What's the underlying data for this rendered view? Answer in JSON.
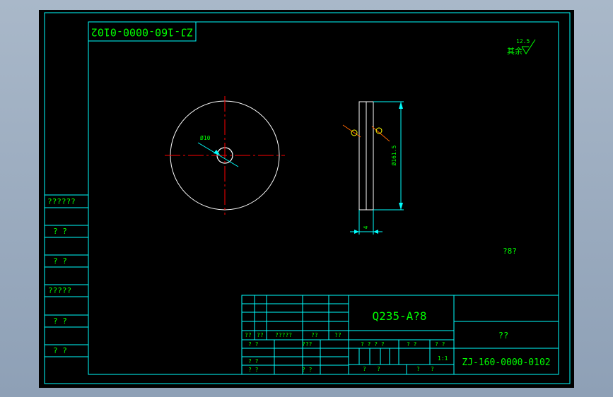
{
  "drawing_number_rotated": "ZJ-160-0000-0102",
  "surface_finish": {
    "label": "其余",
    "value": "12.5"
  },
  "views": {
    "front": {
      "hole_dimension": "Ø10"
    },
    "side": {
      "height_dimension": "Ø161.5",
      "width_dimension": "4"
    }
  },
  "note": "?8?",
  "left_column": [
    "??????",
    "? ?",
    "? ?",
    "?????",
    "? ?",
    "? ?"
  ],
  "title_block": {
    "material": "Q235-A?8",
    "part_name": "??",
    "drawing_number": "ZJ-160-0000-0102",
    "rev_labels": [
      "??",
      "??",
      "?????",
      "??",
      "??"
    ],
    "sign_labels": [
      "? ?",
      "???",
      "? ?",
      "? ?",
      "? ?"
    ],
    "stage_labels": [
      "? ? ? ?",
      "? ?",
      "? ?"
    ],
    "scale": "1:1",
    "sheet_labels": [
      "?",
      "?",
      "?",
      "?"
    ]
  },
  "colors": {
    "frame": "#00ffff",
    "outline": "#ffffff",
    "centerline": "#ff0000",
    "text": "#00ff00",
    "symbol": "#00ff00",
    "background": "#000000"
  }
}
